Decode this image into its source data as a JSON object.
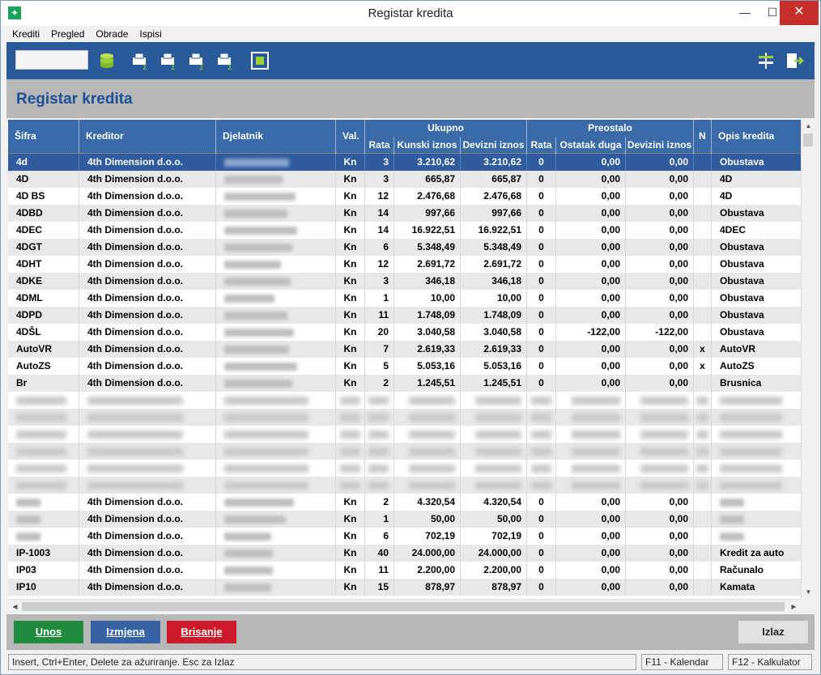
{
  "window": {
    "title": "Registar kredita"
  },
  "menu": [
    "Krediti",
    "Pregled",
    "Obrade",
    "Ispisi"
  ],
  "toolbar": {
    "search_value": "",
    "icons": [
      "database-icon",
      "print-sum-icon",
      "print-sum-icon",
      "print-sum-icon",
      "print-sum-icon",
      "calculator-icon",
      "settings-sliders-icon",
      "exit-icon"
    ]
  },
  "page_title": "Registar kredita",
  "columns": {
    "sifra": "Šifra",
    "kreditor": "Kreditor",
    "djelatnik": "Djelatnik",
    "val": "Val.",
    "ukupno": "Ukupno",
    "rata": "Rata",
    "kunski": "Kunski iznos",
    "devizni": "Devizni iznos",
    "preostalo": "Preostalo",
    "p_rata": "Rata",
    "ostatak": "Ostatak duga",
    "devizini": "Devizini iznos",
    "n": "N",
    "opis": "Opis kredita"
  },
  "rows": [
    {
      "sifra": "4d",
      "kreditor": "4th Dimension d.o.o.",
      "val": "Kn",
      "rata": "3",
      "kunski": "3.210,62",
      "devizni": "3.210,62",
      "p_rata": "0",
      "ostatak": "0,00",
      "devizini": "0,00",
      "n": "",
      "opis": "Obustava",
      "selected": true
    },
    {
      "sifra": "4D",
      "kreditor": "4th Dimension d.o.o.",
      "val": "Kn",
      "rata": "3",
      "kunski": "665,87",
      "devizni": "665,87",
      "p_rata": "0",
      "ostatak": "0,00",
      "devizini": "0,00",
      "n": "",
      "opis": "4D"
    },
    {
      "sifra": "4D BS",
      "kreditor": "4th Dimension d.o.o.",
      "val": "Kn",
      "rata": "12",
      "kunski": "2.476,68",
      "devizni": "2.476,68",
      "p_rata": "0",
      "ostatak": "0,00",
      "devizini": "0,00",
      "n": "",
      "opis": "4D"
    },
    {
      "sifra": "4DBD",
      "kreditor": "4th Dimension d.o.o.",
      "val": "Kn",
      "rata": "14",
      "kunski": "997,66",
      "devizni": "997,66",
      "p_rata": "0",
      "ostatak": "0,00",
      "devizini": "0,00",
      "n": "",
      "opis": "Obustava"
    },
    {
      "sifra": "4DEC",
      "kreditor": "4th Dimension d.o.o.",
      "val": "Kn",
      "rata": "14",
      "kunski": "16.922,51",
      "devizni": "16.922,51",
      "p_rata": "0",
      "ostatak": "0,00",
      "devizini": "0,00",
      "n": "",
      "opis": "4DEC"
    },
    {
      "sifra": "4DGT",
      "kreditor": "4th Dimension d.o.o.",
      "val": "Kn",
      "rata": "6",
      "kunski": "5.348,49",
      "devizni": "5.348,49",
      "p_rata": "0",
      "ostatak": "0,00",
      "devizini": "0,00",
      "n": "",
      "opis": "Obustava"
    },
    {
      "sifra": "4DHT",
      "kreditor": "4th Dimension d.o.o.",
      "val": "Kn",
      "rata": "12",
      "kunski": "2.691,72",
      "devizni": "2.691,72",
      "p_rata": "0",
      "ostatak": "0,00",
      "devizini": "0,00",
      "n": "",
      "opis": "Obustava"
    },
    {
      "sifra": "4DKE",
      "kreditor": "4th Dimension d.o.o.",
      "val": "Kn",
      "rata": "3",
      "kunski": "346,18",
      "devizni": "346,18",
      "p_rata": "0",
      "ostatak": "0,00",
      "devizini": "0,00",
      "n": "",
      "opis": "Obustava"
    },
    {
      "sifra": "4DML",
      "kreditor": "4th Dimension d.o.o.",
      "val": "Kn",
      "rata": "1",
      "kunski": "10,00",
      "devizni": "10,00",
      "p_rata": "0",
      "ostatak": "0,00",
      "devizini": "0,00",
      "n": "",
      "opis": "Obustava"
    },
    {
      "sifra": "4DPD",
      "kreditor": "4th Dimension d.o.o.",
      "val": "Kn",
      "rata": "11",
      "kunski": "1.748,09",
      "devizni": "1.748,09",
      "p_rata": "0",
      "ostatak": "0,00",
      "devizini": "0,00",
      "n": "",
      "opis": "Obustava"
    },
    {
      "sifra": "4DŠL",
      "kreditor": "4th Dimension d.o.o.",
      "val": "Kn",
      "rata": "20",
      "kunski": "3.040,58",
      "devizni": "3.040,58",
      "p_rata": "0",
      "ostatak": "-122,00",
      "devizini": "-122,00",
      "n": "",
      "opis": "Obustava"
    },
    {
      "sifra": "AutoVR",
      "kreditor": "4th Dimension d.o.o.",
      "val": "Kn",
      "rata": "7",
      "kunski": "2.619,33",
      "devizni": "2.619,33",
      "p_rata": "0",
      "ostatak": "0,00",
      "devizini": "0,00",
      "n": "x",
      "opis": "AutoVR"
    },
    {
      "sifra": "AutoZS",
      "kreditor": "4th Dimension d.o.o.",
      "val": "Kn",
      "rata": "5",
      "kunski": "5.053,16",
      "devizni": "5.053,16",
      "p_rata": "0",
      "ostatak": "0,00",
      "devizini": "0,00",
      "n": "x",
      "opis": "AutoZS"
    },
    {
      "sifra": "Br",
      "kreditor": "4th Dimension d.o.o.",
      "val": "Kn",
      "rata": "2",
      "kunski": "1.245,51",
      "devizni": "1.245,51",
      "p_rata": "0",
      "ostatak": "0,00",
      "devizini": "0,00",
      "n": "",
      "opis": "Brusnica"
    },
    {
      "masked": true
    },
    {
      "masked": true
    },
    {
      "masked": true
    },
    {
      "masked": true
    },
    {
      "masked": true
    },
    {
      "masked": true
    },
    {
      "sifra": "",
      "kreditor": "4th Dimension d.o.o.",
      "val": "Kn",
      "rata": "2",
      "kunski": "4.320,54",
      "devizni": "4.320,54",
      "p_rata": "0",
      "ostatak": "0,00",
      "devizini": "0,00",
      "n": "",
      "opis": ""
    },
    {
      "sifra": "",
      "kreditor": "4th Dimension d.o.o.",
      "val": "Kn",
      "rata": "1",
      "kunski": "50,00",
      "devizni": "50,00",
      "p_rata": "0",
      "ostatak": "0,00",
      "devizini": "0,00",
      "n": "",
      "opis": ""
    },
    {
      "sifra": "",
      "kreditor": "4th Dimension d.o.o.",
      "val": "Kn",
      "rata": "6",
      "kunski": "702,19",
      "devizni": "702,19",
      "p_rata": "0",
      "ostatak": "0,00",
      "devizini": "0,00",
      "n": "",
      "opis": ""
    },
    {
      "sifra": "IP-1003",
      "kreditor": "4th Dimension d.o.o.",
      "val": "Kn",
      "rata": "40",
      "kunski": "24.000,00",
      "devizni": "24.000,00",
      "p_rata": "0",
      "ostatak": "0,00",
      "devizini": "0,00",
      "n": "",
      "opis": "Kredit za auto"
    },
    {
      "sifra": "IP03",
      "kreditor": "4th Dimension d.o.o.",
      "val": "Kn",
      "rata": "11",
      "kunski": "2.200,00",
      "devizni": "2.200,00",
      "p_rata": "0",
      "ostatak": "0,00",
      "devizini": "0,00",
      "n": "",
      "opis": "Računalo"
    },
    {
      "sifra": "IP10",
      "kreditor": "4th Dimension d.o.o.",
      "val": "Kn",
      "rata": "15",
      "kunski": "878,97",
      "devizni": "878,97",
      "p_rata": "0",
      "ostatak": "0,00",
      "devizini": "0,00",
      "n": "",
      "opis": "Kamata"
    }
  ],
  "buttons": {
    "unos": "Unos",
    "izmjena": "Izmjena",
    "brisanje": "Brisanje",
    "izlaz": "Izlaz"
  },
  "status": {
    "hint": "Insert, Ctrl+Enter, Delete za ažuriranje. Esc za Izlaz",
    "f11": "F11 - Kalendar",
    "f12": "F12 - Kalkulator"
  }
}
